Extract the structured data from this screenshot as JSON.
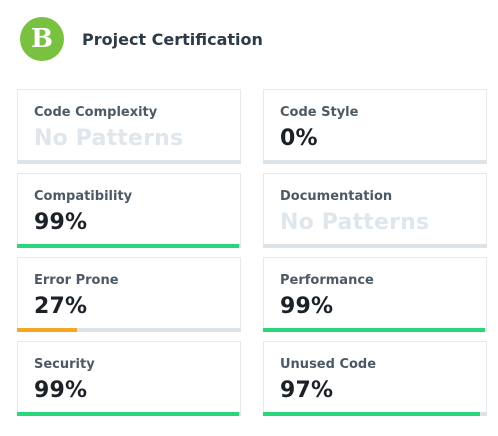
{
  "header": {
    "grade": "B",
    "grade_color": "#7ac142",
    "title": "Project Certification"
  },
  "colors": {
    "good": "#2bd67b",
    "warning": "#f5a623",
    "track": "#dde4e9"
  },
  "metrics": [
    {
      "label": "Code Complexity",
      "value": "No Patterns",
      "has_value": false,
      "progress": 0,
      "status": "none"
    },
    {
      "label": "Code Style",
      "value": "0%",
      "has_value": true,
      "progress": 0,
      "status": "good"
    },
    {
      "label": "Compatibility",
      "value": "99%",
      "has_value": true,
      "progress": 99,
      "status": "good"
    },
    {
      "label": "Documentation",
      "value": "No Patterns",
      "has_value": false,
      "progress": 0,
      "status": "none"
    },
    {
      "label": "Error Prone",
      "value": "27%",
      "has_value": true,
      "progress": 27,
      "status": "warning"
    },
    {
      "label": "Performance",
      "value": "99%",
      "has_value": true,
      "progress": 99,
      "status": "good"
    },
    {
      "label": "Security",
      "value": "99%",
      "has_value": true,
      "progress": 99,
      "status": "good"
    },
    {
      "label": "Unused Code",
      "value": "97%",
      "has_value": true,
      "progress": 97,
      "status": "good"
    }
  ]
}
